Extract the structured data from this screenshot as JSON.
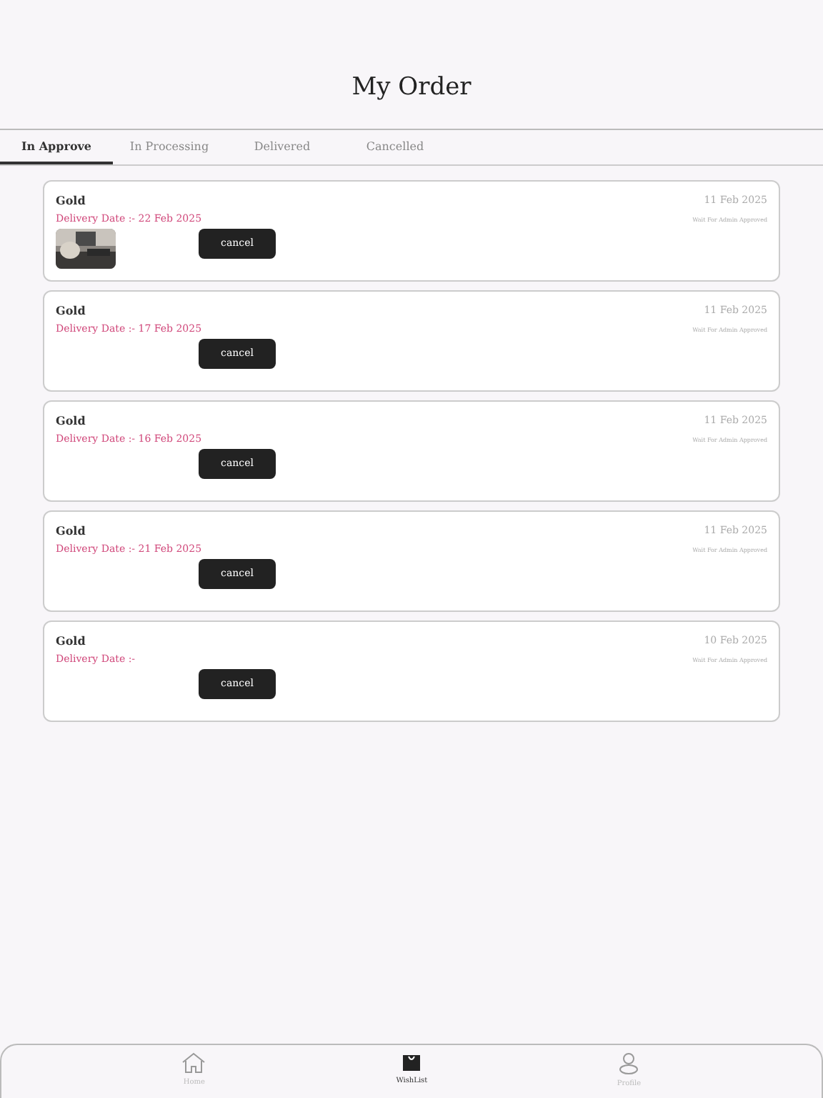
{
  "title": "My Order",
  "tabs": [
    {
      "label": "In Approve",
      "selected": true
    },
    {
      "label": "In Processing",
      "selected": false
    },
    {
      "label": "Delivered",
      "selected": false
    },
    {
      "label": "Cancelled",
      "selected": false
    }
  ],
  "orders": [
    {
      "name": "Gold",
      "date": "11 Feb 2025",
      "delivery": "Delivery Date :- 22 Feb 2025",
      "status": "Wait For Admin Approved",
      "button": "cancel"
    },
    {
      "name": "Gold",
      "date": "11 Feb 2025",
      "delivery": "Delivery Date :- 17 Feb 2025",
      "status": "Wait For Admin Approved",
      "button": "cancel"
    },
    {
      "name": "Gold",
      "date": "11 Feb 2025",
      "delivery": "Delivery Date :- 16 Feb 2025",
      "status": "Wait For Admin Approved",
      "button": "cancel"
    },
    {
      "name": "Gold",
      "date": "11 Feb 2025",
      "delivery": "Delivery Date :- 21 Feb 2025",
      "status": "Wait For Admin Approved",
      "button": "cancel"
    },
    {
      "name": "Gold",
      "date": "10 Feb 2025",
      "delivery": "Delivery Date :-",
      "status": "Wait For Admin Approved",
      "button": "cancel"
    }
  ],
  "nav": [
    {
      "kind": "home",
      "label": "Home",
      "selected": false
    },
    {
      "kind": "bag",
      "label": "WishList",
      "selected": true
    },
    {
      "kind": "profile",
      "label": "Profile",
      "selected": false
    }
  ]
}
